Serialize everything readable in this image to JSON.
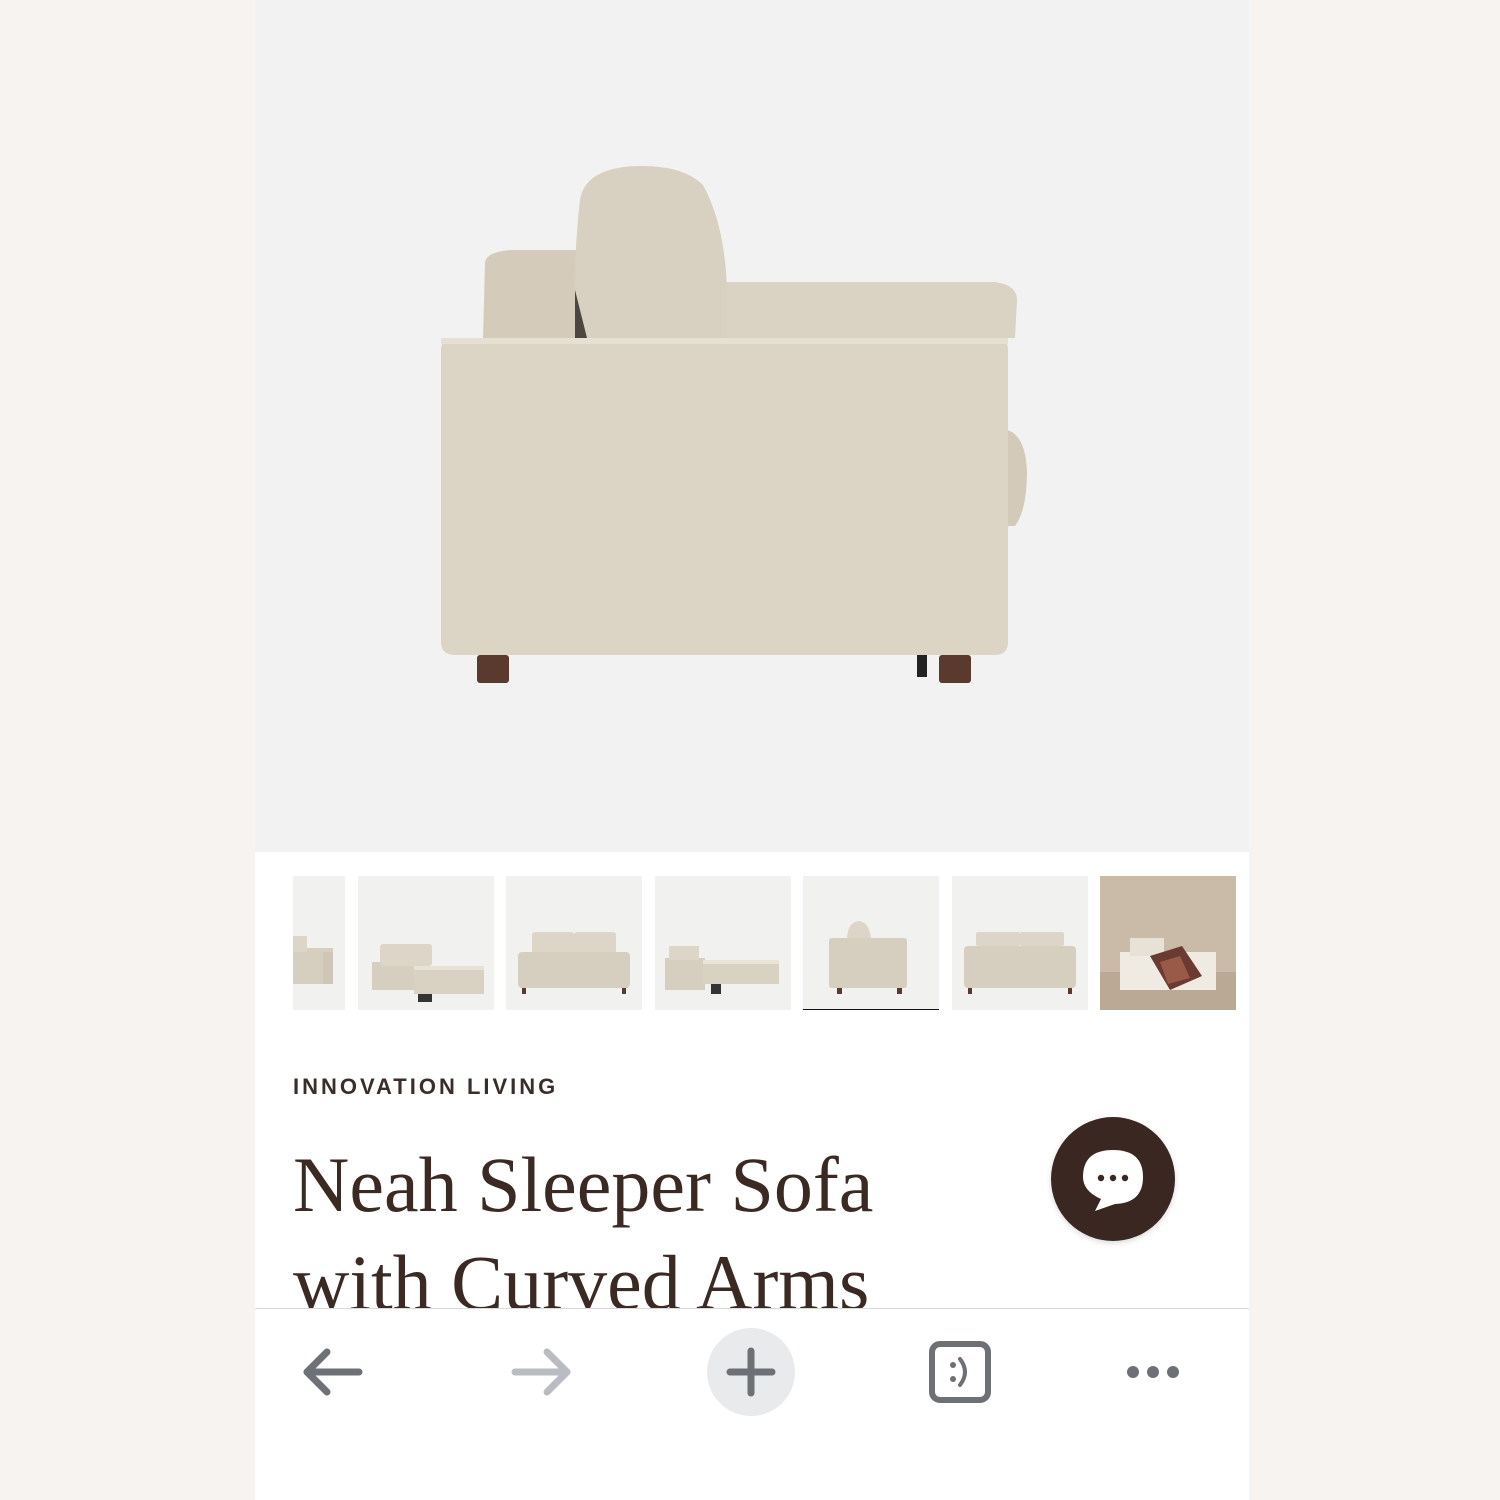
{
  "product": {
    "brand": "INNOVATION LIVING",
    "title_line1": "Neah Sleeper Sofa",
    "title_line2": "with Curved Arms"
  },
  "gallery": {
    "main_image": "sofa-side-view",
    "thumbnails": [
      {
        "name": "thumb-partial-sofa",
        "active": false
      },
      {
        "name": "thumb-sofa-bed-angle",
        "active": false
      },
      {
        "name": "thumb-sofa-front",
        "active": false
      },
      {
        "name": "thumb-sofa-bed-open",
        "active": false
      },
      {
        "name": "thumb-sofa-side",
        "active": true
      },
      {
        "name": "thumb-sofa-back",
        "active": false
      },
      {
        "name": "thumb-lifestyle",
        "active": false
      }
    ]
  },
  "chat": {
    "icon": "chat-bubble-icon"
  },
  "browser_toolbar": {
    "back": "arrow-left-icon",
    "forward": "arrow-right-icon",
    "new_tab": "plus-icon",
    "tabs": "tabs-icon",
    "more": "more-icon"
  },
  "colors": {
    "fabric": "#d9d1c2",
    "legs": "#5a3a2c",
    "title": "#3b2a24",
    "chat_button": "#3a2722",
    "active_indicator": "#111111"
  }
}
